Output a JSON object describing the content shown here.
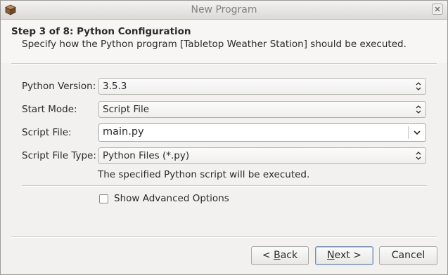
{
  "window": {
    "title": "New Program",
    "app_icon": "box-icon",
    "close_icon": "close-icon"
  },
  "header": {
    "step_title": "Step 3 of 8: Python Configuration",
    "description": "Specify how the Python program [Tabletop Weather Station] should be executed."
  },
  "form": {
    "python_version": {
      "label": "Python Version:",
      "value": "3.5.3"
    },
    "start_mode": {
      "label": "Start Mode:",
      "value": "Script File"
    },
    "script_file": {
      "label": "Script File:",
      "value": "main.py"
    },
    "script_file_type": {
      "label": "Script File Type:",
      "value": "Python Files (*.py)"
    },
    "info_text": "The specified Python script will be executed.",
    "show_advanced": {
      "label": "Show Advanced Options",
      "checked": false
    }
  },
  "buttons": {
    "back": {
      "prefix": "< ",
      "mnemonic": "B",
      "rest": "ack"
    },
    "next": {
      "mnemonic": "N",
      "rest": "ext >"
    },
    "cancel": "Cancel"
  }
}
